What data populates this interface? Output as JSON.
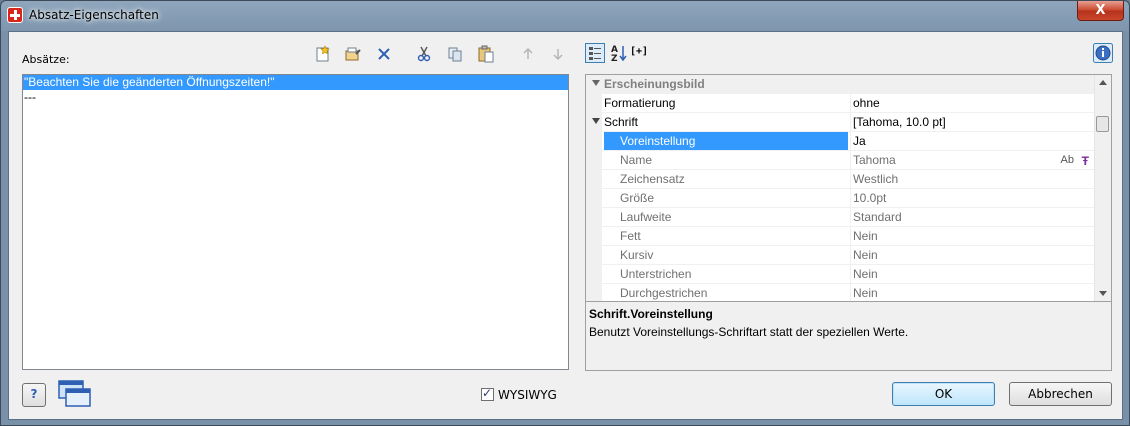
{
  "window": {
    "title": "Absatz-Eigenschaften",
    "close_label": "X"
  },
  "left": {
    "label": "Absätze:",
    "items": [
      "\"Beachten Sie die geänderten Öffnungszeiten!\"",
      "---"
    ]
  },
  "toolbar": {
    "icons": [
      "new-icon",
      "properties-icon",
      "delete-icon",
      "cut-icon",
      "copy-icon",
      "paste-icon",
      "move-up-icon",
      "move-down-icon"
    ]
  },
  "prop_toolbar": {
    "expand_label": "[+]"
  },
  "grid": {
    "rows": [
      {
        "name": "Erscheinungsbild",
        "value": ""
      },
      {
        "name": "Formatierung",
        "value": "ohne"
      },
      {
        "name": "Schrift",
        "value": "[Tahoma, 10.0 pt]"
      },
      {
        "name": "Voreinstellung",
        "value": "Ja"
      },
      {
        "name": "Name",
        "value": "Tahoma"
      },
      {
        "name": "Zeichensatz",
        "value": "Westlich"
      },
      {
        "name": "Größe",
        "value": "10.0pt"
      },
      {
        "name": "Laufweite",
        "value": "Standard"
      },
      {
        "name": "Fett",
        "value": "Nein"
      },
      {
        "name": "Kursiv",
        "value": "Nein"
      },
      {
        "name": "Unterstrichen",
        "value": "Nein"
      },
      {
        "name": "Durchgestrichen",
        "value": "Nein"
      }
    ],
    "font_sample": "Ab",
    "font_icon": "Ŧ"
  },
  "help": {
    "title": "Schrift.Voreinstellung",
    "text": "Benutzt Voreinstellungs-Schriftart statt der speziellen Werte."
  },
  "footer": {
    "wysiwyg_label": "WYSIWYG",
    "wysiwyg_checked": true,
    "ok_label": "OK",
    "cancel_label": "Abbrechen",
    "help_glyph": "?"
  }
}
